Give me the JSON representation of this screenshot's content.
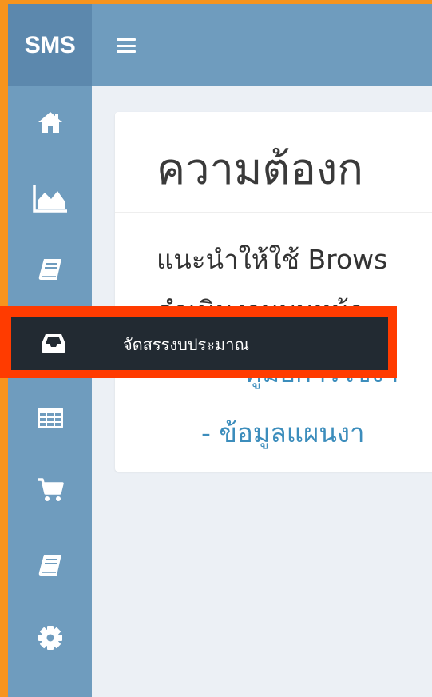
{
  "brand": {
    "title": "SMS"
  },
  "topbar": {
    "menu_icon": "hamburger-icon"
  },
  "sidebar": {
    "items": [
      {
        "icon": "home-icon"
      },
      {
        "icon": "area-chart-icon"
      },
      {
        "icon": "book-icon"
      },
      {
        "icon": "inbox-icon"
      },
      {
        "icon": "table-icon"
      },
      {
        "icon": "shopping-cart-icon"
      },
      {
        "icon": "book-icon"
      },
      {
        "icon": "gear-icon"
      }
    ]
  },
  "tooltip": {
    "icon": "inbox-icon",
    "label": "จัดสรรงบประมาณ"
  },
  "content": {
    "title": "ความต้องก",
    "line1": "แนะนำให้ใช้ Brows",
    "line2": "ดำเนินงานบนหน้า",
    "link1": "- คู่มือการใช้งา",
    "link2": "- ข้อมูลแผนงา"
  },
  "colors": {
    "outer_border": "#f7941d",
    "brand_bg": "#5c88ad",
    "sidebar_bg": "#6f9cbe",
    "content_bg": "#ecf0f5",
    "tooltip_bg": "#222a32",
    "tooltip_outline": "#ff3b00",
    "link": "#3c8dbc"
  }
}
